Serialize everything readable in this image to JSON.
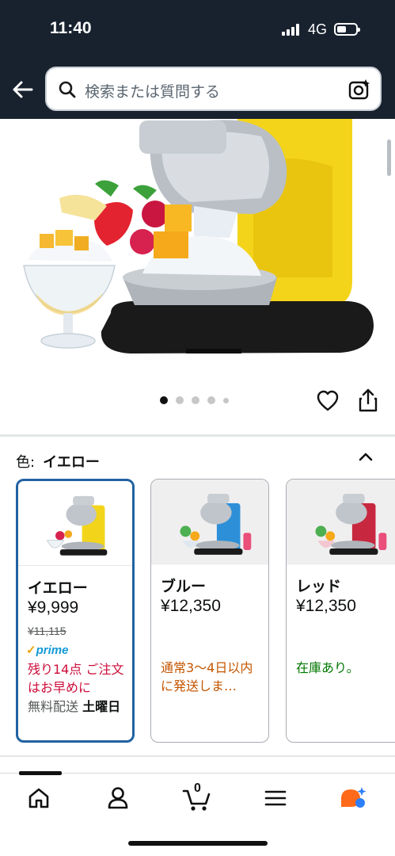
{
  "status_bar": {
    "time": "11:40",
    "network": "4G"
  },
  "search": {
    "placeholder": "検索または質問する"
  },
  "icons": {
    "back": "back-arrow-icon",
    "search": "search-icon",
    "camera": "camera-icon",
    "heart": "heart-icon",
    "share": "share-icon",
    "collapse": "chevron-up-icon"
  },
  "carousel": {
    "total_dots": 5,
    "active_index": 0
  },
  "variant": {
    "label": "色:",
    "selected": "イエロー"
  },
  "swatches": [
    {
      "name": "イエロー",
      "price": "¥9,999",
      "list_price": "¥11,115",
      "prime": "prime",
      "stock": "残り14点 ご注文はお早めに",
      "shipping_prefix": "無料配送",
      "shipping_day": "土曜日",
      "color": "#f2d51b"
    },
    {
      "name": "ブルー",
      "price": "¥12,350",
      "stock": "通常3～4日以内に発送しま…",
      "color": "#2d8fd8"
    },
    {
      "name": "レッド",
      "price": "¥12,350",
      "stock": "在庫あり。",
      "color": "#c8283f"
    }
  ],
  "bottom_nav": {
    "items": [
      "home-icon",
      "account-icon",
      "cart-icon",
      "menu-icon",
      "rufus-icon"
    ],
    "cart_count": "0"
  },
  "colors": {
    "header_bg": "#18222f",
    "selected_border": "#2162a1",
    "prime_blue": "#1399d6",
    "stock_red": "#cc0c39",
    "stock_orange": "#c45500",
    "stock_green": "#007600",
    "rufus_orange": "#ff6a1a",
    "rufus_blue": "#2d7ff9"
  }
}
